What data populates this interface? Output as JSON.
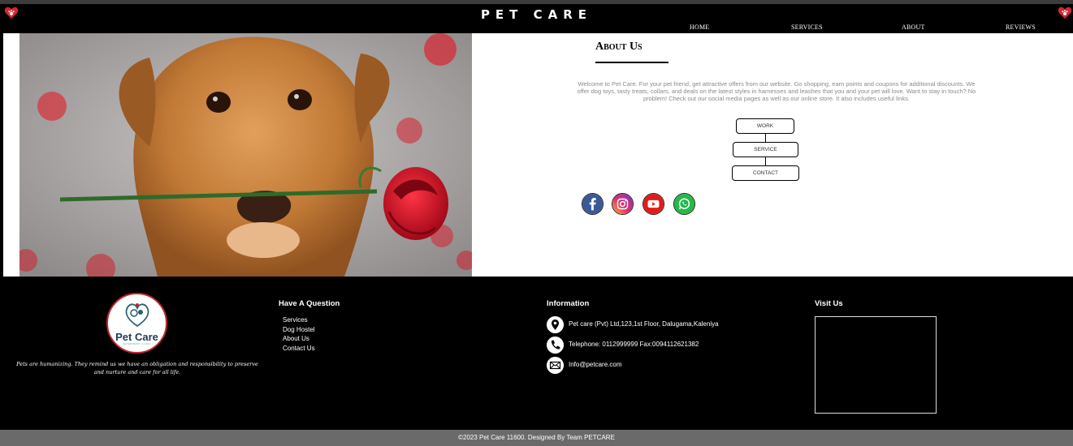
{
  "header": {
    "brand": "PET  CARE",
    "nav": [
      "HOME",
      "SERVICES",
      "ABOUT",
      "REVIEWS"
    ]
  },
  "about": {
    "title": "About Us",
    "text": "Welcome to Pet Care. For your pet friend, get attractive offers from our website. Go shopping, earn points and coupons for additional discounts. We offer dog toys, tasty treats, collars, and deals on the latest styles in harnesses and leashes that you and your pet will love. Want to stay in touch? No problem! Check out our social media pages as well as our online store. It also includes useful links.",
    "flow_buttons": [
      "WORK",
      "SERVICE",
      "CONTACT"
    ],
    "social": [
      "facebook-icon",
      "instagram-icon",
      "youtube-icon",
      "whatsapp-icon"
    ]
  },
  "footer": {
    "logo_text": "Pet Care",
    "logo_sub": "VETERINARY CLINIC",
    "quote": "Pets are humanizing. They remind us we have an obligation and responsibility to preserve and nurture and care for all life.",
    "question_heading": "Have A Question",
    "question_links": [
      "Services",
      "Dog Hostel",
      "About Us",
      "Contact Us"
    ],
    "info_heading": "Information",
    "info_address": "Pet care (Pvt) Ltd,123,1st Floor, Dalugama,Kaleniya",
    "info_phone": "Telephone: 0112999999 Fax:0094112621382",
    "info_email": "Info@petcare.com",
    "visit_heading": "Visit Us",
    "copyright": "©2023 Pet Care 11600. Designed By Team PETCARE"
  },
  "colors": {
    "header_bg": "#000000",
    "footer_bg": "#000000",
    "bottom_bar": "#6a6a6a",
    "accent_red": "#c0282d"
  }
}
